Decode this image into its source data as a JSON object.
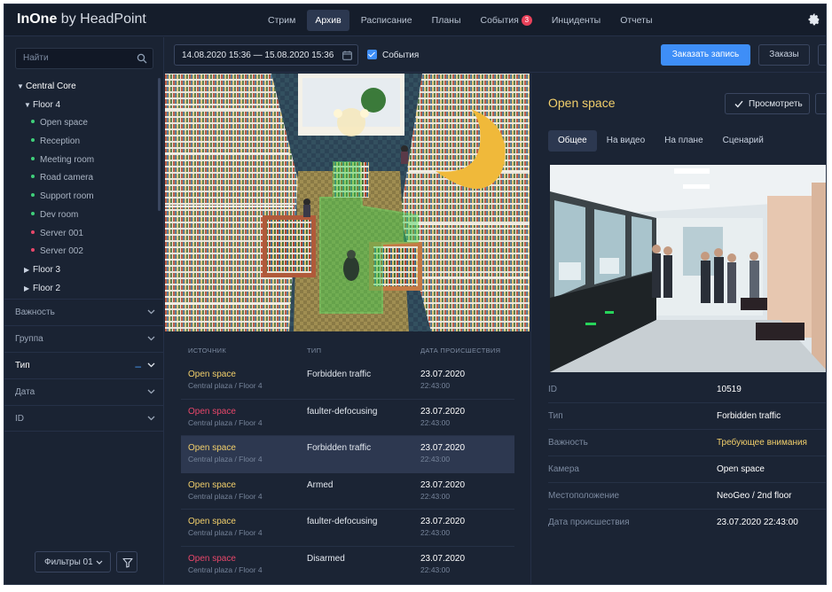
{
  "app": {
    "logo_bold": "InOne",
    "logo_light": "by HeadPoint"
  },
  "nav": {
    "items": [
      {
        "label": "Стрим"
      },
      {
        "label": "Архив"
      },
      {
        "label": "Расписание"
      },
      {
        "label": "Планы"
      },
      {
        "label": "События",
        "badge": "3"
      },
      {
        "label": "Инциденты"
      },
      {
        "label": "Отчеты"
      }
    ],
    "active": "Архив"
  },
  "sidebar": {
    "search_placeholder": "Найти",
    "tree": [
      {
        "label": "Central Core",
        "level": 0,
        "expanded": true
      },
      {
        "label": "Floor 4",
        "level": 1,
        "expanded": true
      },
      {
        "label": "Open space",
        "level": 2,
        "dot": "#3fcf7a",
        "selected": true
      },
      {
        "label": "Reception",
        "level": 2,
        "dot": "#3fcf7a"
      },
      {
        "label": "Meeting room",
        "level": 2,
        "dot": "#3fcf7a"
      },
      {
        "label": "Road camera",
        "level": 2,
        "dot": "#3fcf7a"
      },
      {
        "label": "Support room",
        "level": 2,
        "dot": "#3fcf7a"
      },
      {
        "label": "Dev room",
        "level": 2,
        "dot": "#3fcf7a"
      },
      {
        "label": "Server 001",
        "level": 2,
        "dot": "#e8476a"
      },
      {
        "label": "Server 002",
        "level": 2,
        "dot": "#e8476a"
      },
      {
        "label": "Floor 3",
        "level": 1,
        "expanded": false
      },
      {
        "label": "Floor 2",
        "level": 1,
        "expanded": false
      }
    ],
    "filters": [
      {
        "label": "Важность"
      },
      {
        "label": "Группа"
      },
      {
        "label": "Тип",
        "active": true
      },
      {
        "label": "Дата"
      },
      {
        "label": "ID"
      }
    ],
    "preset_label": "Фильтры 01"
  },
  "toolbar": {
    "date_range": "14.08.2020 15:36 — 15.08.2020 15:36",
    "events_label": "События",
    "order_record_label": "Заказать запись",
    "orders_label": "Заказы"
  },
  "events_table": {
    "headers": [
      "ИСТОЧНИК",
      "ТИП",
      "ДАТА ПРОИСШЕСТВИЯ"
    ],
    "rows": [
      {
        "source": "Open space",
        "location": "Central plaza / Floor 4",
        "type": "Forbidden traffic",
        "date": "23.07.2020",
        "time": "22:43:00",
        "color": "#f2cf6b"
      },
      {
        "source": "Open space",
        "location": "Central plaza / Floor 4",
        "type": "faulter-defocusing",
        "date": "23.07.2020",
        "time": "22:43:00",
        "color": "#e8476a"
      },
      {
        "source": "Open space",
        "location": "Central plaza / Floor 4",
        "type": "Forbidden traffic",
        "date": "23.07.2020",
        "time": "22:43:00",
        "color": "#f2cf6b",
        "selected": true
      },
      {
        "source": "Open space",
        "location": "Central plaza / Floor 4",
        "type": "Armed",
        "date": "23.07.2020",
        "time": "22:43:00",
        "color": "#f2cf6b"
      },
      {
        "source": "Open space",
        "location": "Central plaza / Floor 4",
        "type": "faulter-defocusing",
        "date": "23.07.2020",
        "time": "22:43:00",
        "color": "#f2cf6b"
      },
      {
        "source": "Open space",
        "location": "Central plaza / Floor 4",
        "type": "Disarmed",
        "date": "23.07.2020",
        "time": "22:43:00",
        "color": "#e8476a"
      }
    ]
  },
  "detail": {
    "title": "Open space",
    "view_label": "Просмотреть",
    "tabs": [
      "Общее",
      "На видео",
      "На плане",
      "Сценарий"
    ],
    "active_tab": "Общее",
    "properties": [
      {
        "key": "ID",
        "value": "10519"
      },
      {
        "key": "Тип",
        "value": "Forbidden traffic"
      },
      {
        "key": "Важность",
        "value": "Требующее внимания",
        "warn": true
      },
      {
        "key": "Камера",
        "value": "Open space"
      },
      {
        "key": "Местоположение",
        "value": "NeoGeo / 2nd floor"
      },
      {
        "key": "Дата происшествия",
        "value": "23.07.2020 22:43:00"
      }
    ]
  },
  "colors": {
    "accent": "#3e8ef7",
    "warning": "#f2cf6b",
    "alarm": "#e8476a",
    "online": "#3fcf7a"
  }
}
